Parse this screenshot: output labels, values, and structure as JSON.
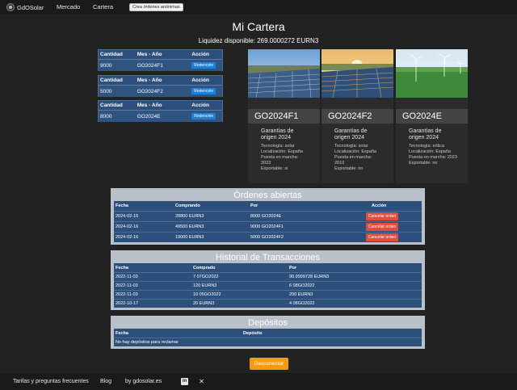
{
  "nav": {
    "brand": "GdOSolar",
    "links": [
      "Mercado",
      "Cartera"
    ],
    "anon_button": "Crea órdenes anónimas"
  },
  "page": {
    "title": "Mi Cartera",
    "liquidity": "Liquidez disponible: 269.0000272 EURN3"
  },
  "holdings": {
    "headers": [
      "Cantidad",
      "Mes - Año",
      "Acción"
    ],
    "rows": [
      {
        "qty": "9000",
        "period": "GO2024F1",
        "action": "Redención"
      },
      {
        "qty": "5000",
        "period": "GO2024F2",
        "action": "Redención"
      },
      {
        "qty": "8000",
        "period": "GO2024E",
        "action": "Redención"
      }
    ]
  },
  "cards": [
    {
      "name": "GO2024F1",
      "subtitle": "Garantías de origen 2024",
      "lines": [
        "Tecnología: solar",
        "Localización: España",
        "Puesta en marcha: 2023",
        "Exportable: si"
      ],
      "image": "solar-farm-image"
    },
    {
      "name": "GO2024F2",
      "subtitle": "Garantías de origen 2024",
      "lines": [
        "Tecnología: solar",
        "Localización: España",
        "Puesta en marcha: 2010",
        "Exportable: no"
      ],
      "image": "solar-farm-sunset-image"
    },
    {
      "name": "GO2024E",
      "subtitle": "Garantías de origen 2024",
      "lines": [
        "Tecnología: eólica",
        "Localización: España",
        "Puesta en marcha: 2023",
        "Exportable: no"
      ],
      "image": "wind-farm-image"
    }
  ],
  "open_orders": {
    "title": "Órdenes abiertas",
    "headers": [
      "Fecha",
      "Comprando",
      "Por",
      "Acción"
    ],
    "rows": [
      {
        "date": "2024-02-16",
        "buying": "28800 EURN3",
        "for": "8000 GO2024E",
        "action": "Cancelar orden"
      },
      {
        "date": "2024-02-16",
        "buying": "49500 EURN3",
        "for": "9000 GO2024F1",
        "action": "Cancelar orden"
      },
      {
        "date": "2024-02-16",
        "buying": "19000 EURN3",
        "for": "5000 GO2024F2",
        "action": "Cancelar orden"
      }
    ]
  },
  "history": {
    "title": "Historial de Transacciones",
    "headers": [
      "Fecha",
      "Comprado",
      "Por"
    ],
    "rows": [
      {
        "date": "2022-11-03",
        "bought": "7 07GO2022",
        "for": "90.9999728 EURN3"
      },
      {
        "date": "2022-11-03",
        "bought": "120 EURN3",
        "for": "6 08GO2022"
      },
      {
        "date": "2022-11-03",
        "bought": "10 05GO2022",
        "for": "200 EURN3"
      },
      {
        "date": "2022-10-17",
        "bought": "20 EURN3",
        "for": "4 08GO2022"
      }
    ]
  },
  "deposits": {
    "title": "Depósitos",
    "headers": [
      "Fecha",
      "Depósito"
    ],
    "empty": "No hay depósitos para reclamar"
  },
  "disconnect": "Desconectar",
  "footer": {
    "links": [
      "Tarifas y preguntas frecuentes",
      "Blog",
      "by gdosolar.es"
    ],
    "icons": [
      "linkedin-icon",
      "x-icon"
    ]
  },
  "colors": {
    "background": "#222222",
    "navbar": "#1a1a1a",
    "table_blue": "#2c4f7c",
    "panel_gray": "#b9c0c9",
    "redeem_button": "#1e7fd6",
    "cancel_button": "#e34b3c",
    "disconnect_button": "#f39c12"
  }
}
